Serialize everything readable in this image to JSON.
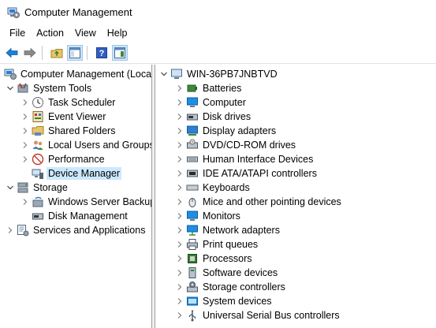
{
  "window": {
    "title": "Computer Management"
  },
  "menu": {
    "file": "File",
    "action": "Action",
    "view": "View",
    "help": "Help"
  },
  "tree": {
    "root": "Computer Management (Local",
    "system_tools": "System Tools",
    "task_scheduler": "Task Scheduler",
    "event_viewer": "Event Viewer",
    "shared_folders": "Shared Folders",
    "local_users": "Local Users and Groups",
    "performance": "Performance",
    "device_manager": "Device Manager",
    "storage": "Storage",
    "wsb": "Windows Server Backup",
    "disk_mgmt": "Disk Management",
    "services": "Services and Applications"
  },
  "devices": {
    "host": "WIN-36PB7JNBTVD",
    "items": [
      "Batteries",
      "Computer",
      "Disk drives",
      "Display adapters",
      "DVD/CD-ROM drives",
      "Human Interface Devices",
      "IDE ATA/ATAPI controllers",
      "Keyboards",
      "Mice and other pointing devices",
      "Monitors",
      "Network adapters",
      "Print queues",
      "Processors",
      "Software devices",
      "Storage controllers",
      "System devices",
      "Universal Serial Bus controllers"
    ]
  },
  "colors": {
    "selection": "#cce8ff",
    "accent": "#0078d7",
    "chevron": "#606060"
  }
}
